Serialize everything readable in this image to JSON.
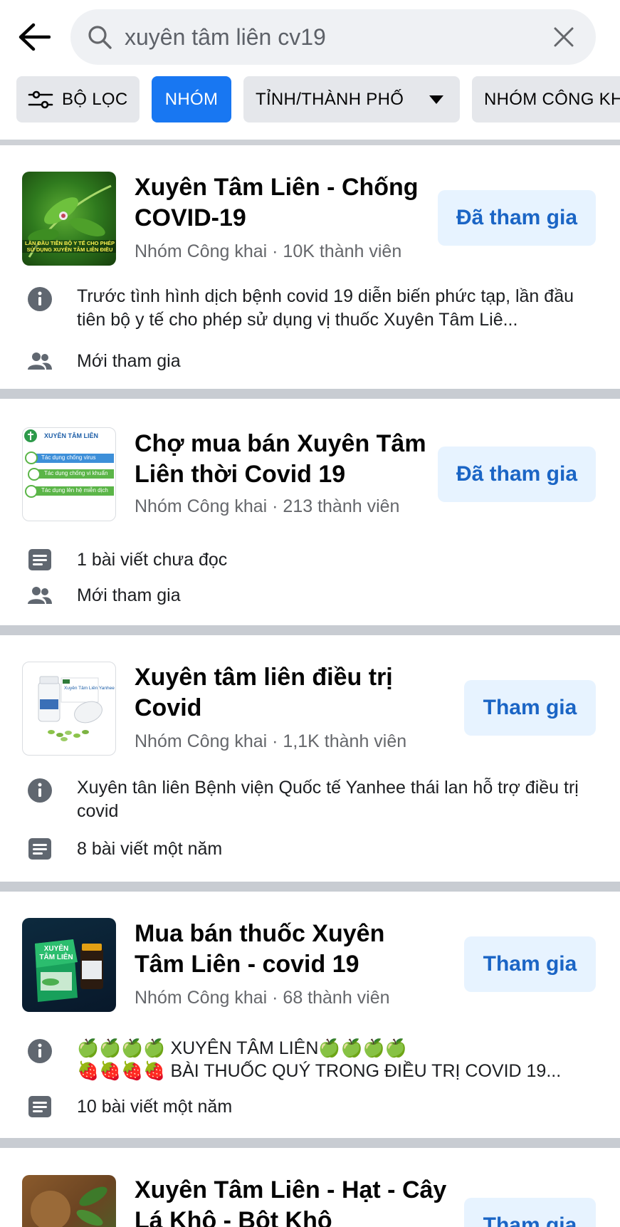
{
  "search": {
    "query": "xuyên tâm liên cv19"
  },
  "filters": [
    {
      "label": "BỘ LỌC"
    },
    {
      "label": "NHÓM"
    },
    {
      "label": "TỈNH/THÀNH PHỐ"
    },
    {
      "label": "NHÓM CÔNG KH"
    }
  ],
  "groups": [
    {
      "title": "Xuyên Tâm Liên - Chống COVID-19",
      "meta": "Nhóm Công khai · 10K thành viên",
      "button": "Đã tham gia",
      "thumb_text": "LẦN ĐẦU TIÊN BỘ Y TẾ CHO PHÉP SỬ DỤNG XUYÊN TÂM LIÊN ĐIỀU TRỊ COVID",
      "info": "Trước tình hình dịch bệnh covid 19 diễn biến phức tạp, lần đầu tiên bộ y tế cho phép sử dụng vị thuốc Xuyên Tâm Liê...",
      "members": "Mới tham gia"
    },
    {
      "title": "Chợ mua bán Xuyên Tâm Liên thời Covid 19",
      "meta": "Nhóm Công khai · 213 thành viên",
      "button": "Đã tham gia",
      "thumb_heading": "XUYÊN TÂM LIÊN",
      "thumb_lines": [
        "Tác dụng chống virus",
        "Tác dụng chống vi khuẩn",
        "Tác dụng lên hệ miễn dịch"
      ],
      "posts": "1 bài viết chưa đọc",
      "members": "Mới tham gia"
    },
    {
      "title": "Xuyên tâm liên điều trị Covid",
      "meta": "Nhóm Công khai · 1,1K thành viên",
      "button": "Tham gia",
      "thumb_text": "Xuyên Tâm Liên Yanhee",
      "info": "Xuyên tân liên Bệnh viện Quốc tế Yanhee thái lan hỗ trợ điều trị covid",
      "posts": "8 bài viết một năm"
    },
    {
      "title": "Mua bán thuốc Xuyên Tâm Liên - covid 19",
      "meta": "Nhóm Công khai · 68 thành viên",
      "button": "Tham gia",
      "thumb_text": "XUYÊN TÂM LIÊN",
      "info_line1": "🍏🍏🍏🍏 XUYÊN TÂM LIÊN🍏🍏🍏🍏",
      "info_line2": "🍓🍓🍓🍓 BÀI THUỐC QUÝ TRONG ĐIỀU TRỊ  COVID 19...",
      "posts": "10 bài viết một năm"
    },
    {
      "title": "Xuyên Tâm Liên - Hạt - Cây Lá Khô - Bột Khô",
      "button": "Tham gia"
    }
  ]
}
